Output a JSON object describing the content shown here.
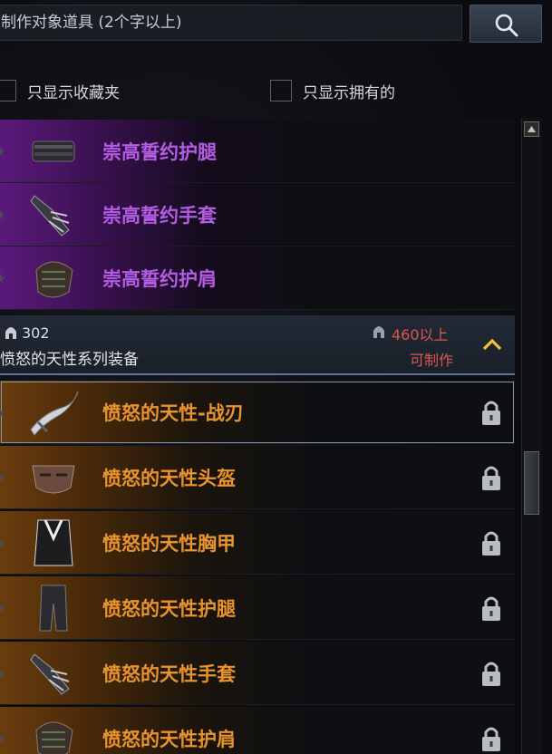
{
  "search": {
    "placeholder": "制作对象道具 (2个字以上)",
    "visible_text": "制作对象道具 (2个字以上)"
  },
  "filters": [
    {
      "label": "只显示收藏夹",
      "checked": false
    },
    {
      "label": "只显示拥有的",
      "checked": false
    }
  ],
  "top_items": [
    {
      "label": "崇高誓约护腿",
      "icon": "leg-armor-icon"
    },
    {
      "label": "崇高誓约手套",
      "icon": "gauntlet-icon"
    },
    {
      "label": "崇高誓约护肩",
      "icon": "pauldron-icon"
    }
  ],
  "group": {
    "level": "302",
    "title": "愤怒的天性系列装备",
    "requirement": "460以上",
    "craft_label": "可制作"
  },
  "group_items": [
    {
      "label": "愤怒的天性-战刃",
      "icon": "blade-icon",
      "locked": true
    },
    {
      "label": "愤怒的天性头盔",
      "icon": "mask-helmet-icon",
      "locked": true
    },
    {
      "label": "愤怒的天性胸甲",
      "icon": "chest-armor-icon",
      "locked": true
    },
    {
      "label": "愤怒的天性护腿",
      "icon": "leg-armor-icon",
      "locked": true
    },
    {
      "label": "愤怒的天性手套",
      "icon": "gauntlet-icon",
      "locked": true
    },
    {
      "label": "愤怒的天性护肩",
      "icon": "pauldron-icon",
      "locked": true
    }
  ],
  "colors": {
    "epic": "#b55ce6",
    "legendary": "#e9932e",
    "requirement_red": "#d9584b"
  }
}
